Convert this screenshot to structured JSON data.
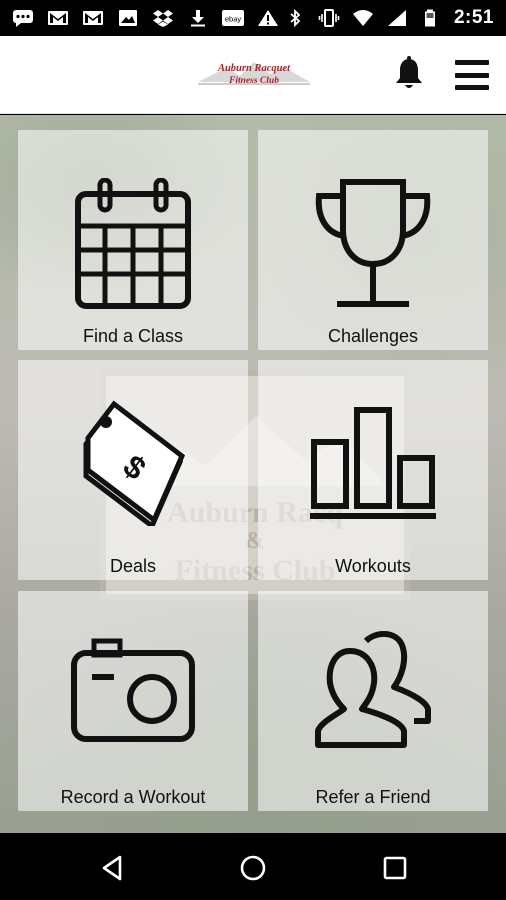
{
  "status_bar": {
    "time": "2:51",
    "left_icons": [
      "chat-bubble-icon",
      "gmail-icon",
      "gmail-icon",
      "image-icon",
      "dropbox-icon",
      "download-icon",
      "ebay-icon",
      "warning-icon"
    ],
    "right_icons": [
      "bluetooth-icon",
      "vibrate-icon",
      "wifi-icon",
      "signal-icon",
      "battery-icon"
    ],
    "ebay_text": "ebay"
  },
  "header": {
    "logo_line1": "Auburn Racquet",
    "logo_line2": "Fitness Club",
    "brand_color": "#b21e2a"
  },
  "tiles": [
    {
      "label": "Find a Class",
      "icon": "calendar-icon"
    },
    {
      "label": "Challenges",
      "icon": "trophy-icon"
    },
    {
      "label": "Deals",
      "icon": "price-tag-icon"
    },
    {
      "label": "Workouts",
      "icon": "bar-chart-icon"
    },
    {
      "label": "Record a Workout",
      "icon": "camera-icon"
    },
    {
      "label": "Refer a Friend",
      "icon": "people-icon"
    }
  ],
  "background_sign": {
    "line1": "Auburn Racq",
    "line2": "&",
    "line3": "Fitness Club"
  },
  "nav": {
    "buttons": [
      "back-icon",
      "home-icon",
      "recents-icon"
    ]
  }
}
